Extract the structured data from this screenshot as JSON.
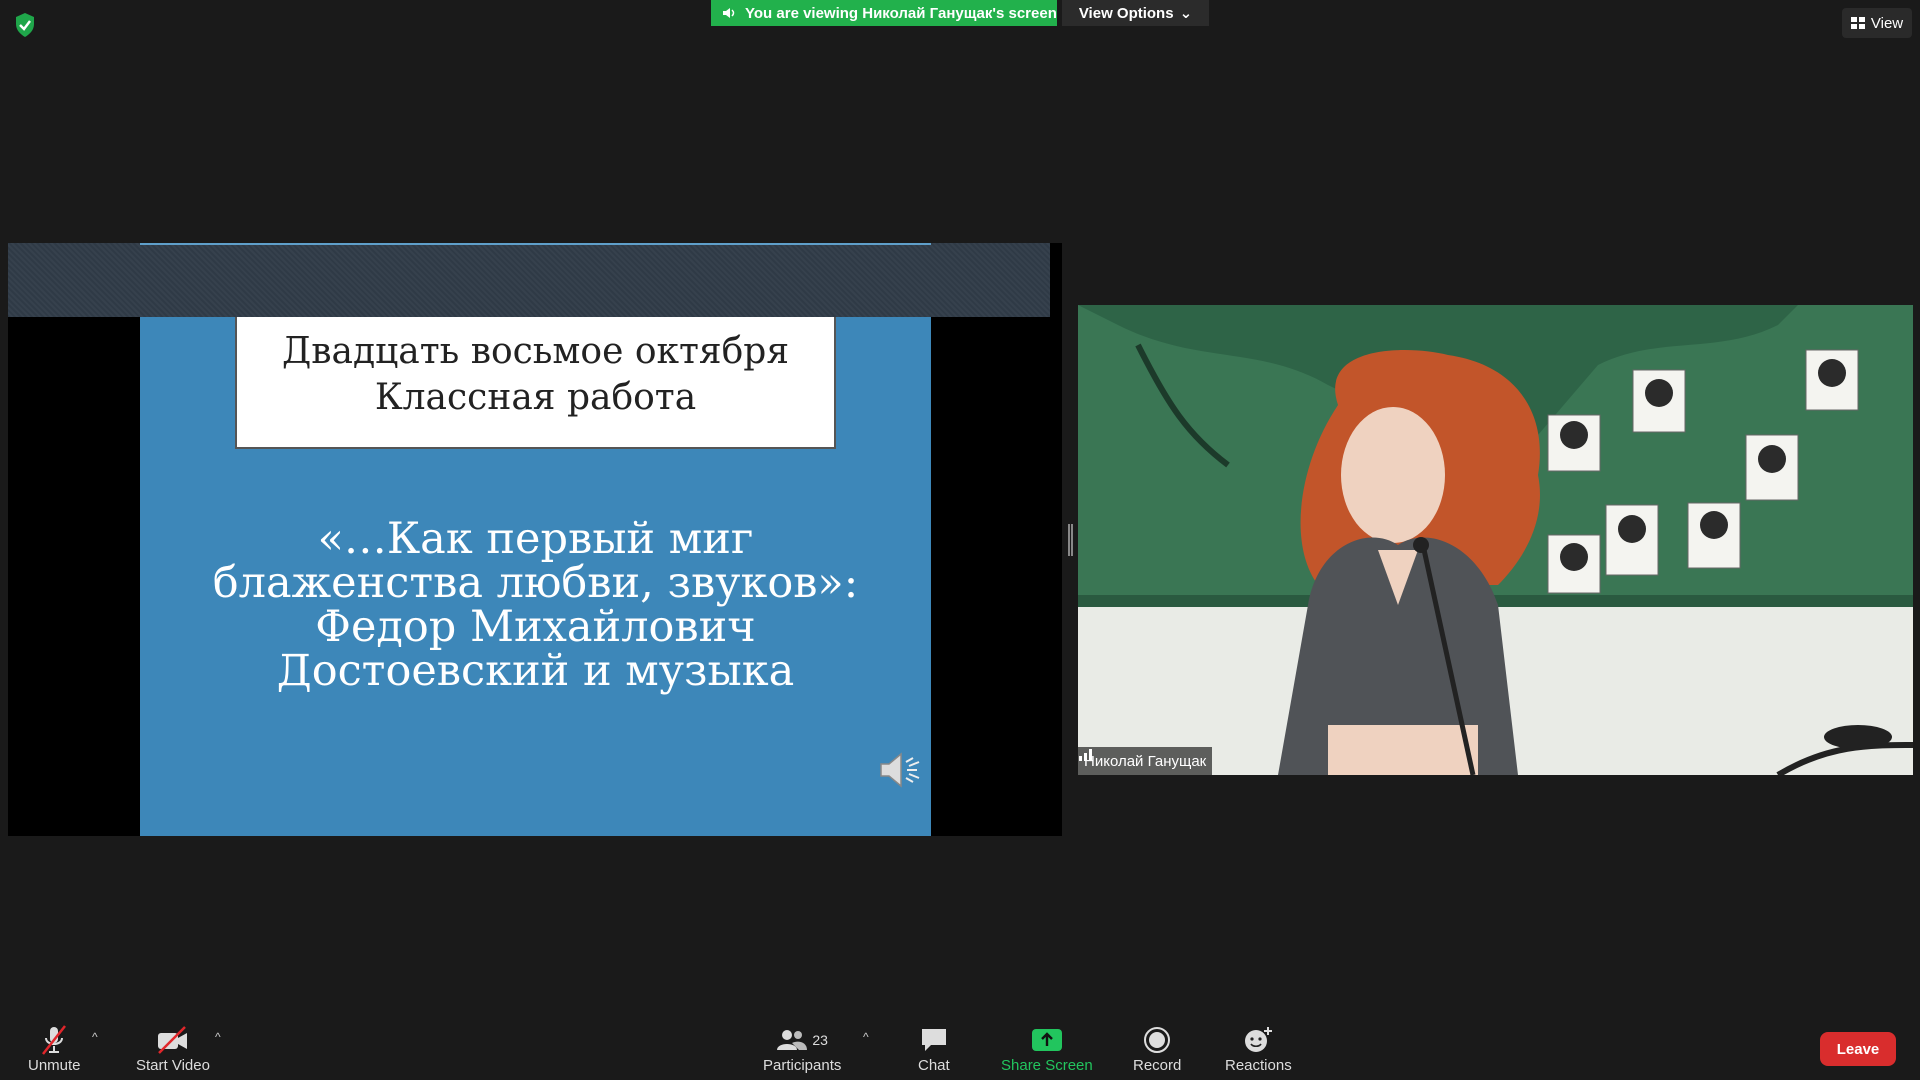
{
  "top": {
    "banner_text": "You are viewing Николай Ганущак's screen",
    "view_options_label": "View Options",
    "view_label": "View"
  },
  "slide": {
    "title_line1": "Двадцать восьмое октября",
    "title_line2": "Классная работа",
    "body_line1": "«…Как первый миг",
    "body_line2": "блаженства любви, звуков»:",
    "body_line3": "Федор Михайлович",
    "body_line4": "Достоевский и музыка"
  },
  "video": {
    "participant_name": "Николай Ганущак"
  },
  "toolbar": {
    "unmute_label": "Unmute",
    "start_video_label": "Start Video",
    "participants_label": "Participants",
    "participants_count": "23",
    "chat_label": "Chat",
    "share_label": "Share Screen",
    "record_label": "Record",
    "reactions_label": "Reactions",
    "leave_label": "Leave"
  },
  "colors": {
    "banner_green": "#22b14c",
    "slide_blue": "#3d87b9",
    "leave_red": "#d92d2d"
  }
}
